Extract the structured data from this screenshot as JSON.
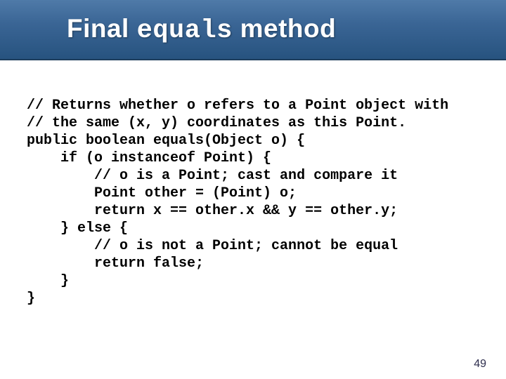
{
  "title": {
    "part1": "Final ",
    "mono": "equals",
    "part2": " method"
  },
  "code": "// Returns whether o refers to a Point object with\n// the same (x, y) coordinates as this Point.\npublic boolean equals(Object o) {\n    if (o instanceof Point) {\n        // o is a Point; cast and compare it\n        Point other = (Point) o;\n        return x == other.x && y == other.y;\n    } else {\n        // o is not a Point; cannot be equal\n        return false;\n    }\n}",
  "slide_number": "49"
}
